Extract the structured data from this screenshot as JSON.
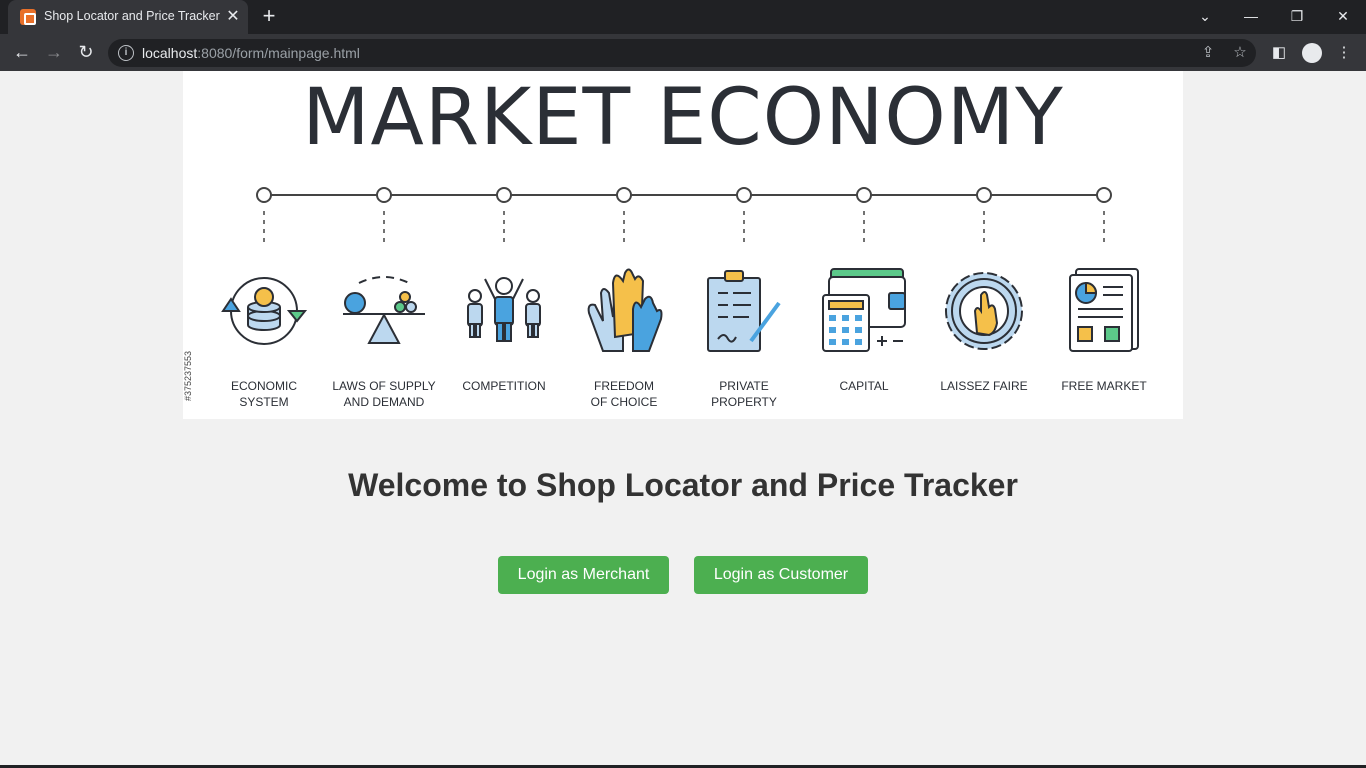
{
  "browser": {
    "tab_title": "Shop Locator and Price Tracker",
    "url_host": "localhost",
    "url_rest": ":8080/form/mainpage.html"
  },
  "banner": {
    "title": "MARKET ECONOMY",
    "stock_id": "#375237553",
    "items": [
      {
        "line1": "ECONOMIC",
        "line2": "SYSTEM"
      },
      {
        "line1": "LAWS OF SUPPLY",
        "line2": "AND DEMAND"
      },
      {
        "line1": "COMPETITION",
        "line2": ""
      },
      {
        "line1": "FREEDOM",
        "line2": "OF CHOICE"
      },
      {
        "line1": "PRIVATE",
        "line2": "PROPERTY"
      },
      {
        "line1": "CAPITAL",
        "line2": ""
      },
      {
        "line1": "LAISSEZ FAIRE",
        "line2": ""
      },
      {
        "line1": "FREE MARKET",
        "line2": ""
      }
    ]
  },
  "main": {
    "welcome": "Welcome to Shop Locator and Price Tracker",
    "merchant_button": "Login as Merchant",
    "customer_button": "Login as Customer"
  },
  "colors": {
    "button": "#4caf50",
    "chrome_dark": "#202124",
    "chrome_toolbar": "#35363a"
  }
}
